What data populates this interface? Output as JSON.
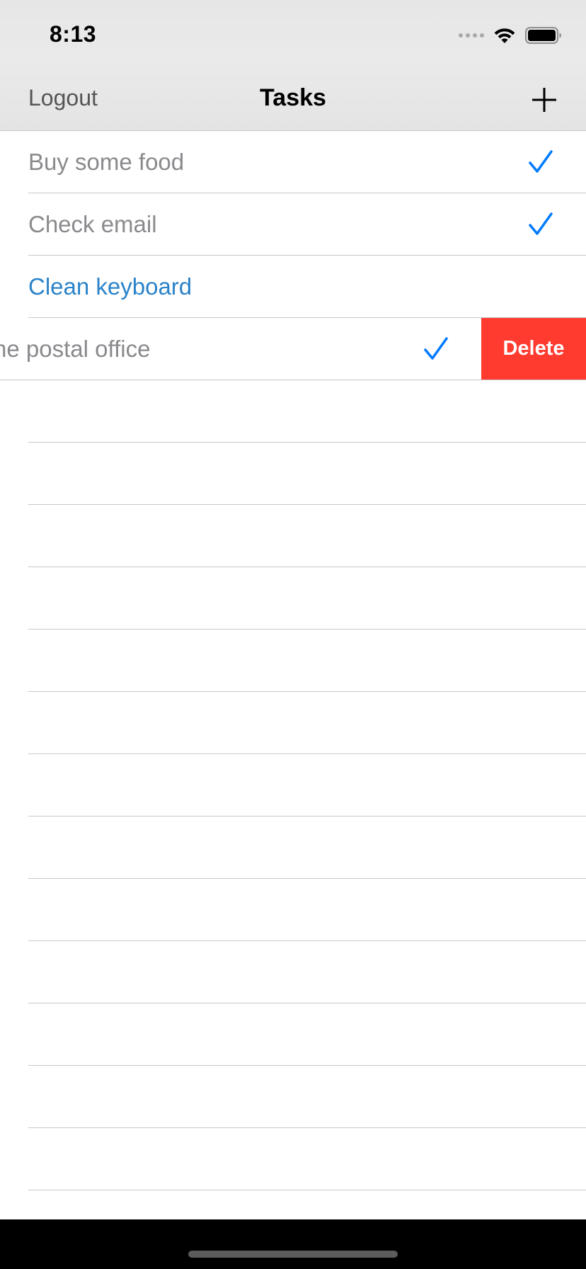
{
  "status_bar": {
    "time": "8:13",
    "icons": [
      "cellular-signal-icon",
      "wifi-icon",
      "battery-icon"
    ]
  },
  "nav": {
    "left_label": "Logout",
    "title": "Tasks",
    "right_icon": "plus-icon"
  },
  "tasks": [
    {
      "label": "Buy some food",
      "done": true
    },
    {
      "label": "Check email",
      "done": true
    },
    {
      "label": "Clean keyboard",
      "done": false
    },
    {
      "label": "Go to the postal office",
      "done": true,
      "swiped": true
    }
  ],
  "swipe_action": {
    "label": "Delete",
    "color": "#ff3b30"
  },
  "empty_rows": 13,
  "colors": {
    "accent": "#007aff",
    "active_text": "#2b83c9",
    "done_text": "#8a8a8e",
    "separator": "#c8c8cc"
  }
}
